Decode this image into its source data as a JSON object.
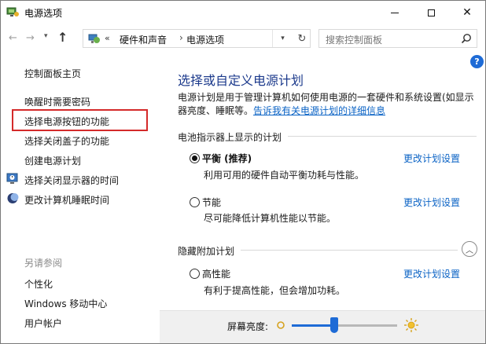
{
  "window": {
    "title": "电源选项"
  },
  "nav": {
    "breadcrumb_prefix": "«",
    "breadcrumb": [
      "硬件和声音",
      "电源选项"
    ],
    "search_placeholder": "搜索控制面板"
  },
  "sidebar": {
    "home": "控制面板主页",
    "links": [
      "唤醒时需要密码",
      "选择电源按钮的功能",
      "选择关闭盖子的功能",
      "创建电源计划",
      "选择关闭显示器的时间",
      "更改计算机睡眠时间"
    ],
    "highlighted_index": 1,
    "see_also_title": "另请参阅",
    "see_also": [
      "个性化",
      "Windows 移动中心",
      "用户帐户"
    ]
  },
  "main": {
    "title": "选择或自定义电源计划",
    "description_line1": "电源计划是用于管理计算机如何使用电源的一套硬件和系统设置(如显示",
    "description_line2_prefix": "器亮度、睡眠等。",
    "description_link": "告诉我有关电源计划的详细信息",
    "battery_group_title": "电池指示器上显示的计划",
    "plans": [
      {
        "name": "平衡 (推荐)",
        "desc": "利用可用的硬件自动平衡功耗与性能。",
        "selected": true,
        "change": "更改计划设置"
      },
      {
        "name": "节能",
        "desc": "尽可能降低计算机性能以节能。",
        "selected": false,
        "change": "更改计划设置"
      }
    ],
    "hidden_group_title": "隐藏附加计划",
    "hidden_plans": [
      {
        "name": "高性能",
        "desc": "有利于提高性能，但会增加功耗。",
        "selected": false,
        "change": "更改计划设置"
      }
    ]
  },
  "footer": {
    "brightness_label": "屏幕亮度:",
    "brightness_level": 0.4
  },
  "colors": {
    "accent": "#1e6bd6",
    "link": "#0b63c5",
    "title": "#1c3a8c",
    "highlight": "#d42a2a"
  }
}
